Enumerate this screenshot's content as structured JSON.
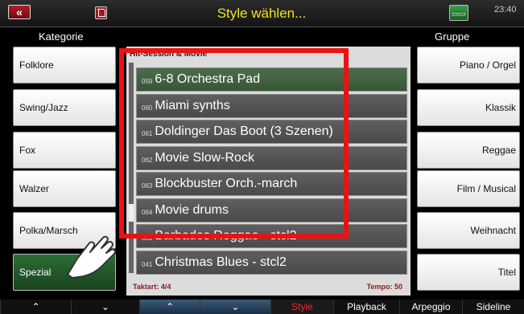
{
  "topbar": {
    "back_label": "«",
    "title": "Style wählen...",
    "clock": "23:40",
    "icons": {
      "back": "back-arrow-icon",
      "delete": "trash-icon",
      "status": "hdd-icon"
    }
  },
  "headers": {
    "left": "Kategorie",
    "right": "Gruppe"
  },
  "categories": [
    "Folklore",
    "Swing/Jazz",
    "Fox",
    "Walzer",
    "Polka/Marsch",
    "Spezial"
  ],
  "groups": [
    "Piano  /  Orgel",
    "Klassik",
    "Reggae",
    "Film  /  Musical",
    "Weihnacht",
    "Titel"
  ],
  "list": {
    "title": "Hit-Session & Movie",
    "items": [
      {
        "num": "059",
        "name": "6-8 Orchestra Pad"
      },
      {
        "num": "060",
        "name": "Miami synths"
      },
      {
        "num": "061",
        "name": "Doldinger Das Boot (3 Szenen)"
      },
      {
        "num": "062",
        "name": "Movie Slow-Rock"
      },
      {
        "num": "063",
        "name": "Blockbuster Orch.-march"
      },
      {
        "num": "064",
        "name": "Movie drums"
      },
      {
        "num": "031",
        "name": "Barbados Reggae - stcl2"
      },
      {
        "num": "041",
        "name": "Christmas Blues - stcl2"
      }
    ],
    "footer_left": "Taktart: 4/4",
    "footer_right": "Tempo: 50"
  },
  "bottom": {
    "up1": "⌃",
    "down1": "⌄",
    "up2": "⌃",
    "down2": "⌄",
    "style": "Style",
    "playback": "Playback",
    "arpeggio": "Arpeggio",
    "sideline": "Sideline"
  },
  "colors": {
    "title": "#f2e51e",
    "selected": "#2d6d36",
    "highlight": "#ee1111"
  }
}
